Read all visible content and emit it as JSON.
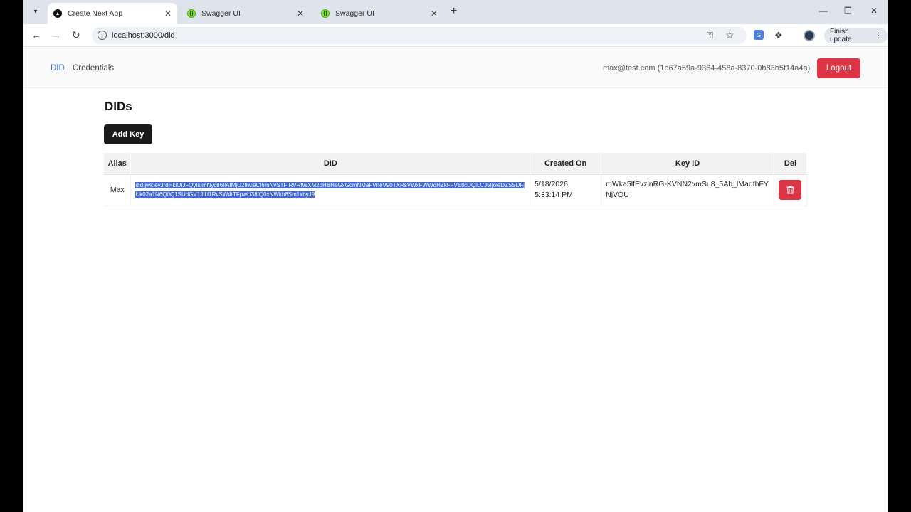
{
  "browser": {
    "tabs": [
      {
        "label": "Create Next App",
        "active": true,
        "favicon": "next-icon"
      },
      {
        "label": "Swagger UI",
        "active": false,
        "favicon": "swagger-icon"
      },
      {
        "label": "Swagger UI",
        "active": false,
        "favicon": "swagger-icon"
      }
    ],
    "url": "localhost:3000/did",
    "finish_update_label": "Finish update"
  },
  "nav": {
    "did_label": "DID",
    "credentials_label": "Credentials",
    "user_info": "max@test.com (1b67a59a-9364-458a-8370-0b83b5f14a4a)",
    "logout_label": "Logout"
  },
  "page": {
    "title": "DIDs",
    "add_key_label": "Add Key"
  },
  "table": {
    "headers": {
      "alias": "Alias",
      "did": "DID",
      "created_on": "Created On",
      "key_id": "Key ID",
      "del": "Del"
    },
    "rows": [
      {
        "alias": "Max",
        "did": "did:jwk:eyJrdHkiOiJFQyIsImNydiI6IlAtMjU2IiwieCI6InNvSTFIRVRtWXM2dHBHeGxGcmNMaFVneV90TXRsVWxFWWdHZkFFVEtlcDQiLCJ5IjoieDZSSDFjUk02a1N6Q0Q1SUdGV1JIU1RvSW4tTFpwU38fQ0xNWkh6Sm1xbyJ9",
        "created_date": "5/18/2026,",
        "created_time": "5:33:14 PM",
        "key_id": "mWka5lfEvzlnRG-KVNN2vmSu8_5Ab_lMaqfhFYNjVOU"
      }
    ]
  },
  "colors": {
    "accent": "#3b6fd6",
    "danger": "#dc3545",
    "selection": "#3f67d8"
  }
}
